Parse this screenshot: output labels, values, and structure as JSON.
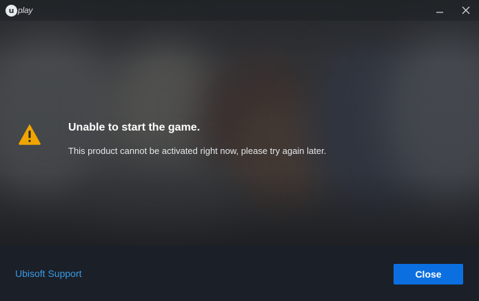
{
  "app": {
    "logo_text": "play",
    "logo_letter": "u"
  },
  "titlebar": {
    "minimize_icon": "minimize-icon",
    "close_icon": "close-icon"
  },
  "message": {
    "icon": "warning-icon",
    "icon_color": "#f0a500",
    "title": "Unable to start the game.",
    "body": "This product cannot be activated right now, please try again later."
  },
  "footer": {
    "support_label": "Ubisoft Support",
    "support_color": "#3a9be6",
    "close_label": "Close",
    "close_color": "#0b6fe0"
  }
}
